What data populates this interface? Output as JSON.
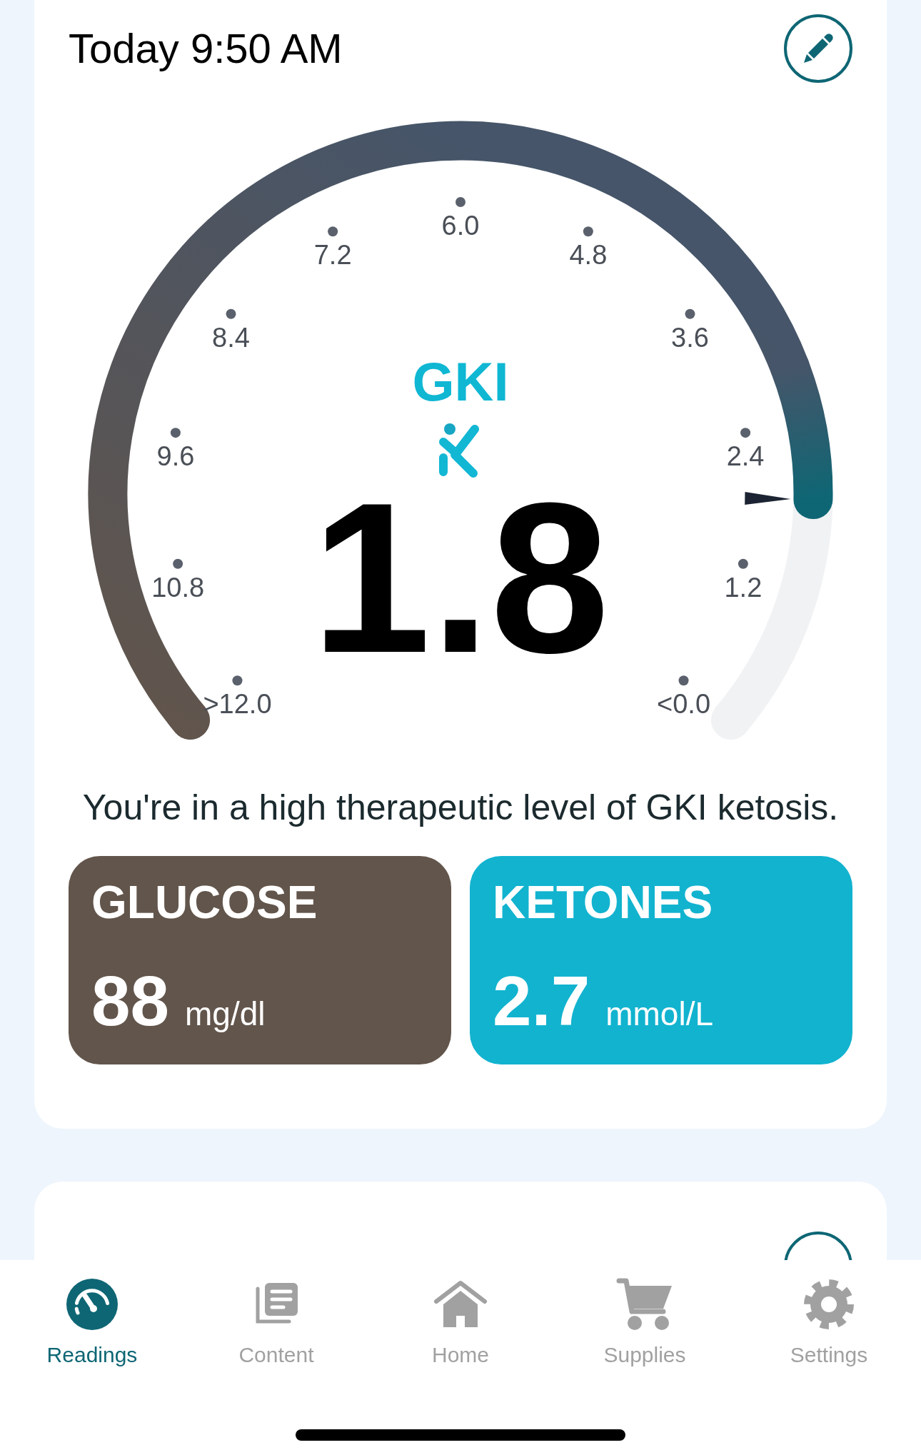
{
  "reading": {
    "time_label": "Today 9:50 AM",
    "gauge": {
      "title": "GKI",
      "value": "1.8",
      "ticks": [
        ">12.0",
        "10.8",
        "9.6",
        "8.4",
        "7.2",
        "6.0",
        "4.8",
        "3.6",
        "2.4",
        "1.2",
        "<0.0"
      ]
    },
    "message": "You're in a high therapeutic level of GKI ketosis.",
    "tiles": [
      {
        "label": "GLUCOSE",
        "value": "88",
        "unit": "mg/dl",
        "color": "#62554b"
      },
      {
        "label": "KETONES",
        "value": "2.7",
        "unit": "mmol/L",
        "color": "#12b3cf"
      }
    ]
  },
  "tab_bar": [
    {
      "label": "Readings",
      "selected": true
    },
    {
      "label": "Content",
      "selected": false
    },
    {
      "label": "Home",
      "selected": false
    },
    {
      "label": "Supplies",
      "selected": false
    },
    {
      "label": "Settings",
      "selected": false
    }
  ]
}
